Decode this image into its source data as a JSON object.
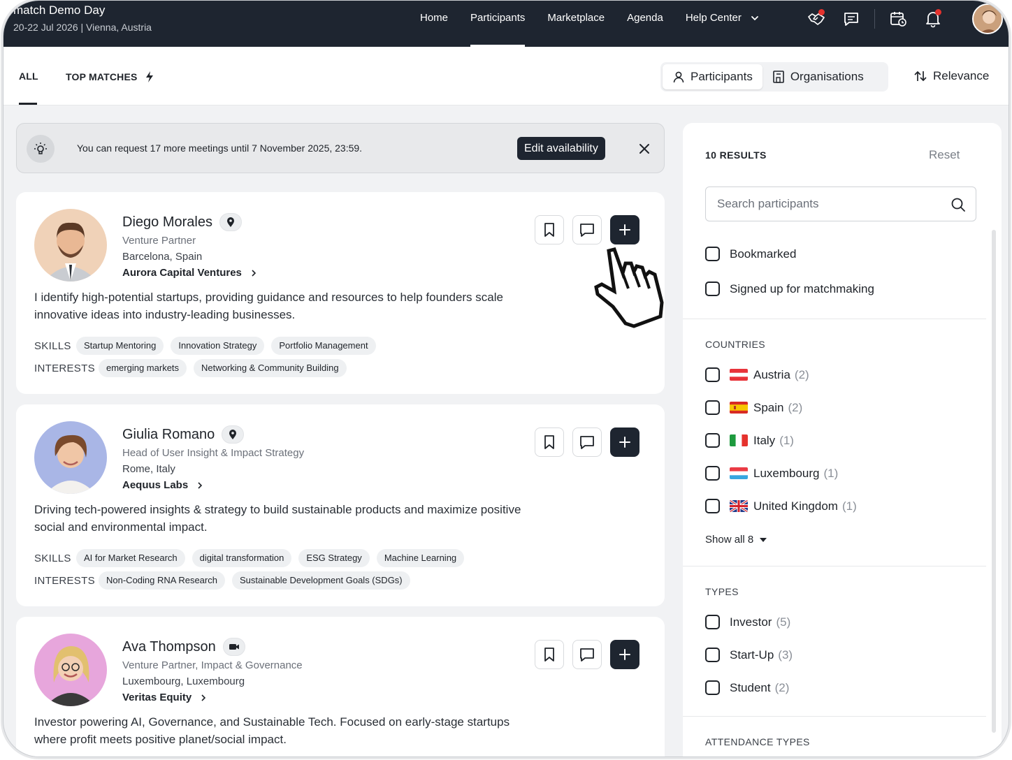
{
  "event": {
    "title": "match Demo Day",
    "subtitle": "20-22 Jul 2026 | Vienna, Austria"
  },
  "nav": {
    "items": [
      {
        "label": "Home"
      },
      {
        "label": "Participants",
        "active": true
      },
      {
        "label": "Marketplace"
      },
      {
        "label": "Agenda"
      },
      {
        "label": "Help Center"
      }
    ]
  },
  "tabs": {
    "all": "ALL",
    "top_matches": "TOP MATCHES"
  },
  "segment": {
    "participants": "Participants",
    "organisations": "Organisations"
  },
  "sort": {
    "label": "Relevance"
  },
  "banner": {
    "text": "You can request 17 more meetings until 7 November 2025, 23:59.",
    "button": "Edit availability"
  },
  "labels": {
    "skills": "SKILLS",
    "interests": "INTERESTS"
  },
  "participants": [
    {
      "name": "Diego Morales",
      "badge_icon": "location-pin-icon",
      "role": "Venture Partner",
      "location": "Barcelona, Spain",
      "organisation": "Aurora Capital Ventures",
      "bio": "I identify high-potential startups, providing guidance and resources to help founders scale innovative ideas into industry-leading businesses.",
      "skills": [
        "Startup Mentoring",
        "Innovation Strategy",
        "Portfolio Management"
      ],
      "interests": [
        "emerging markets",
        "Networking & Community Building"
      ]
    },
    {
      "name": "Giulia Romano",
      "badge_icon": "location-pin-icon",
      "role": "Head of User Insight & Impact Strategy",
      "location": "Rome, Italy",
      "organisation": "Aequus Labs",
      "bio": "Driving tech-powered insights & strategy to build sustainable products and maximize positive social and environmental impact.",
      "skills": [
        "AI for Market Research",
        "digital transformation",
        "ESG Strategy",
        "Machine Learning"
      ],
      "interests": [
        "Non-Coding RNA Research",
        "Sustainable Development Goals (SDGs)"
      ]
    },
    {
      "name": "Ava Thompson",
      "badge_icon": "video-camera-icon",
      "role": "Venture Partner, Impact & Governance",
      "location": "Luxembourg, Luxembourg",
      "organisation": "Veritas Equity",
      "bio": "Investor powering AI, Governance, and Sustainable Tech. Focused on early-stage startups where profit meets positive planet/social impact."
    }
  ],
  "filters": {
    "results": "10 RESULTS",
    "reset": "Reset",
    "search_placeholder": "Search participants",
    "general": [
      {
        "label": "Bookmarked"
      },
      {
        "label": "Signed up for matchmaking"
      }
    ],
    "countries_title": "COUNTRIES",
    "countries": [
      {
        "label": "Austria",
        "count": "(2)"
      },
      {
        "label": "Spain",
        "count": "(2)"
      },
      {
        "label": "Italy",
        "count": "(1)"
      },
      {
        "label": "Luxembourg",
        "count": "(1)"
      },
      {
        "label": "United Kingdom",
        "count": "(1)"
      }
    ],
    "show_all": "Show all 8",
    "types_title": "TYPES",
    "types": [
      {
        "label": "Investor",
        "count": "(5)"
      },
      {
        "label": "Start-Up",
        "count": "(3)"
      },
      {
        "label": "Student",
        "count": "(2)"
      }
    ],
    "attendance_title": "ATTENDANCE TYPES"
  },
  "colors": {
    "navbar": "#1e2530",
    "accent_dark": "#1e2530",
    "notification": "#e5322d"
  }
}
